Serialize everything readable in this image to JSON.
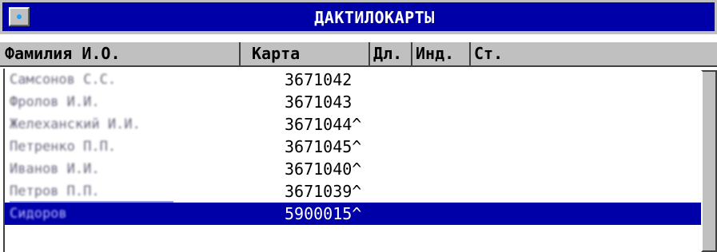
{
  "window": {
    "title": "ДАКТИЛОКАРТЫ"
  },
  "columns": {
    "name": "Фамилия И.О.",
    "card": "Карта",
    "dl": "Дл.",
    "ind": "Инд.",
    "st": "Ст."
  },
  "rows": [
    {
      "name": "Самсонов С.С.",
      "card": "3671042"
    },
    {
      "name": "Фролов И.И.",
      "card": "3671043"
    },
    {
      "name": "Желеханский И.И.",
      "card": "3671044^"
    },
    {
      "name": "Петренко П.П.",
      "card": "3671045^"
    },
    {
      "name": "Иванов И.И.",
      "card": "3671040^"
    },
    {
      "name": "Петров П.П.",
      "card": "3671039^"
    },
    {
      "name": "Сидоров",
      "card": "5900015^"
    }
  ],
  "selected_row": 6,
  "colors": {
    "titlebar": "#0000a8",
    "selection": "#0000a8",
    "chrome": "#c0c0c0"
  }
}
